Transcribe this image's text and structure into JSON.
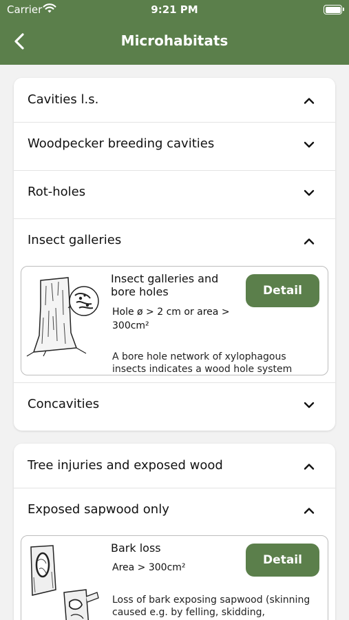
{
  "status_bar": {
    "carrier": "Carrier",
    "time": "9:21 PM",
    "wifi_icon": "wifi-icon",
    "battery_icon": "battery-icon"
  },
  "nav": {
    "title": "Microhabitats",
    "back_icon": "chevron-left-icon"
  },
  "colors": {
    "brand_green": "#5b7f4b",
    "background": "#f2f2f2",
    "card": "#ffffff"
  },
  "groups": [
    {
      "label": "Cavities l.s.",
      "expanded": true,
      "subgroups": [
        {
          "label": "Woodpecker breeding cavities",
          "expanded": false
        },
        {
          "label": "Rot-holes",
          "expanded": false
        },
        {
          "label": "Insect galleries",
          "expanded": true,
          "item": {
            "name": "Insect galleries and bore holes",
            "criterion": "Hole ø > 2 cm or area > 300cm²",
            "description": "A bore hole network of xylophagous insects indicates a wood hole system",
            "detail_label": "Detail"
          }
        },
        {
          "label": "Concavities",
          "expanded": false
        }
      ]
    },
    {
      "label": "Tree injuries and exposed wood",
      "expanded": true,
      "subgroups": [
        {
          "label": "Exposed sapwood only",
          "expanded": true,
          "item": {
            "name": "Bark loss",
            "criterion": "Area > 300cm²",
            "description": "Loss of bark exposing sapwood (skinning caused e.g. by felling, skidding,",
            "detail_label": "Detail"
          }
        }
      ]
    }
  ]
}
